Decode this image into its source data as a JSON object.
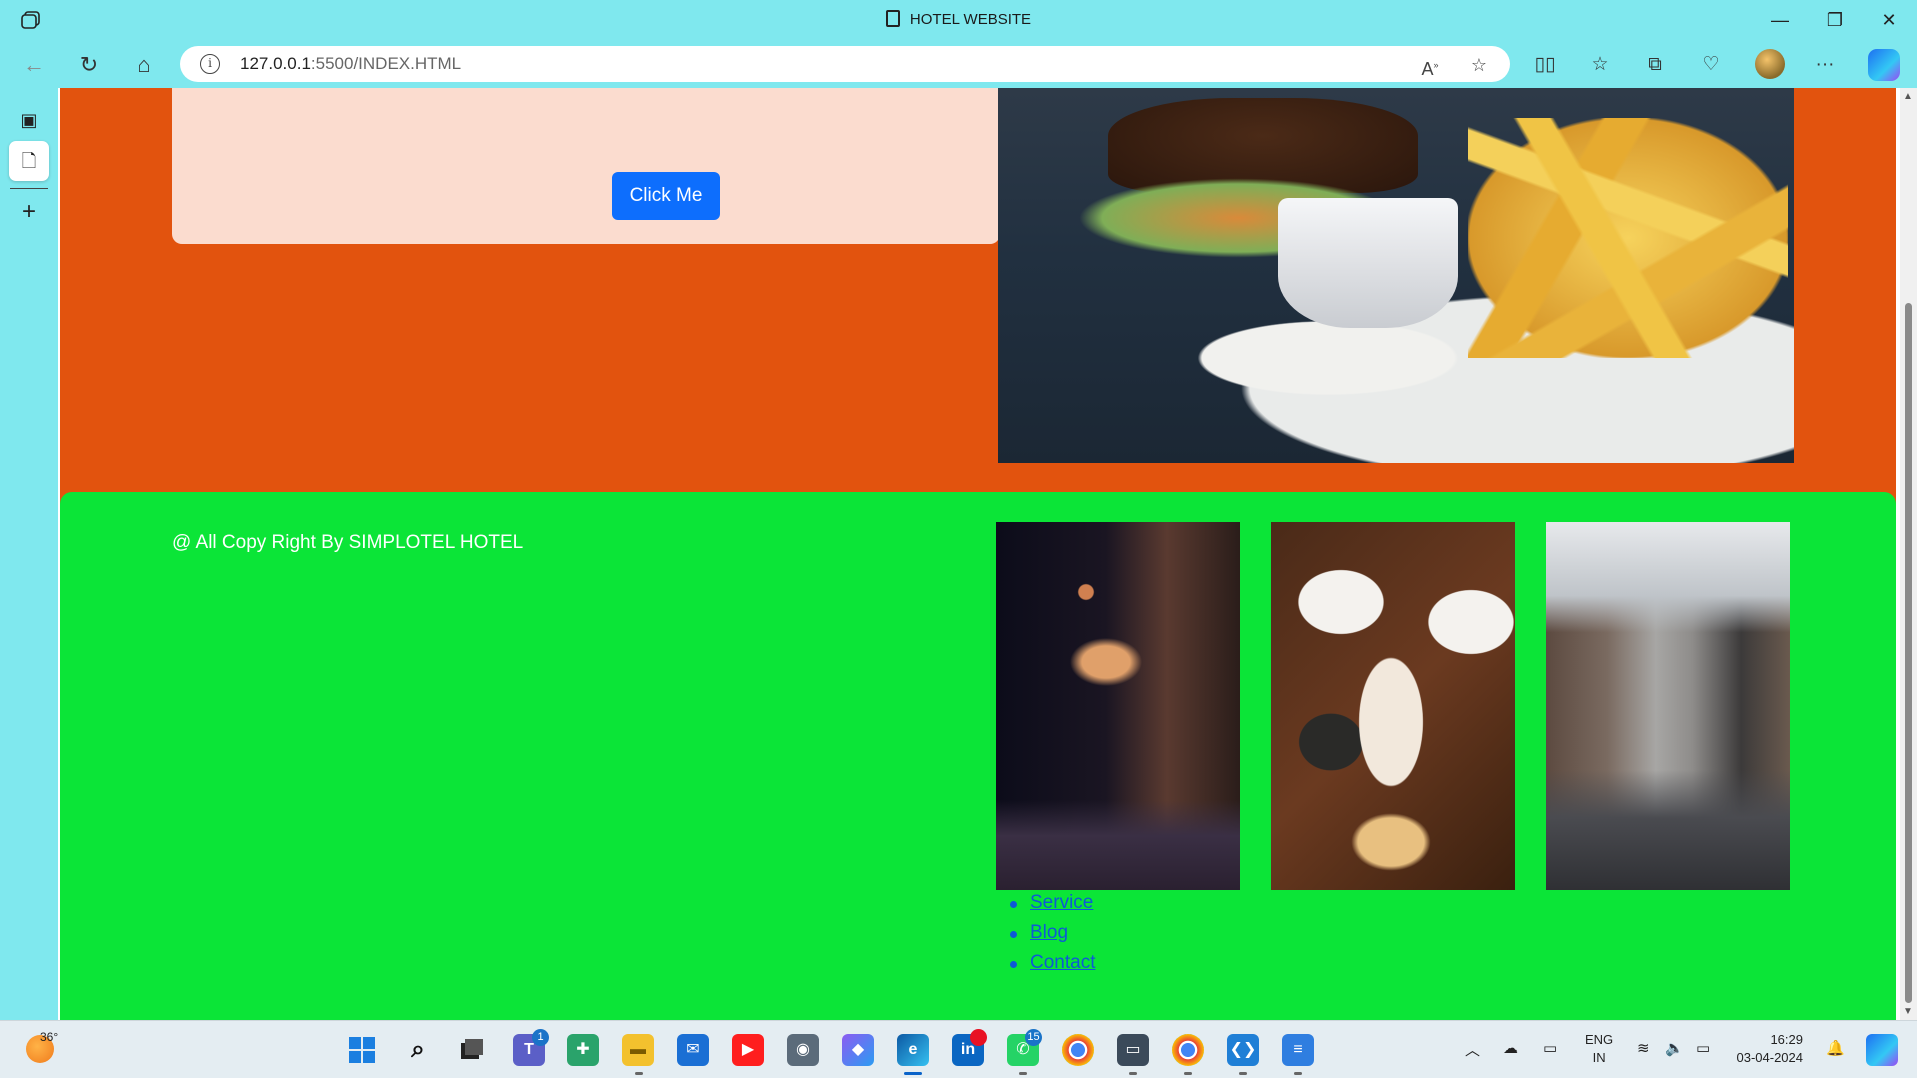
{
  "window": {
    "title": "HOTEL WEBSITE",
    "minimize": "—",
    "restore": "❐",
    "close": "✕"
  },
  "address_bar": {
    "url_host": "127.0.0.1",
    "url_rest": ":5500/INDEX.HTML"
  },
  "page": {
    "button_label": "Click Me",
    "copyright": "@ All Copy Right By SIMPLOTEL HOTEL",
    "footer_links": [
      "Service",
      "Blog",
      "Contact"
    ],
    "colors": {
      "orange_section": "#e2530e",
      "peach_card": "#fbdccf",
      "green_footer": "#0be537",
      "button": "#0d6efd",
      "link": "#0d5ad6"
    },
    "images": [
      "burger-and-fries-photo",
      "stage-nightlife-street-photo",
      "seafood-dishes-table-photo",
      "cafe-alley-street-photo"
    ]
  },
  "taskbar": {
    "weather_temp": "36°",
    "teams_badge": "1",
    "whatsapp_badge": "15",
    "lang_line1": "ENG",
    "lang_line2": "IN",
    "time": "16:29",
    "date": "03-04-2024"
  }
}
